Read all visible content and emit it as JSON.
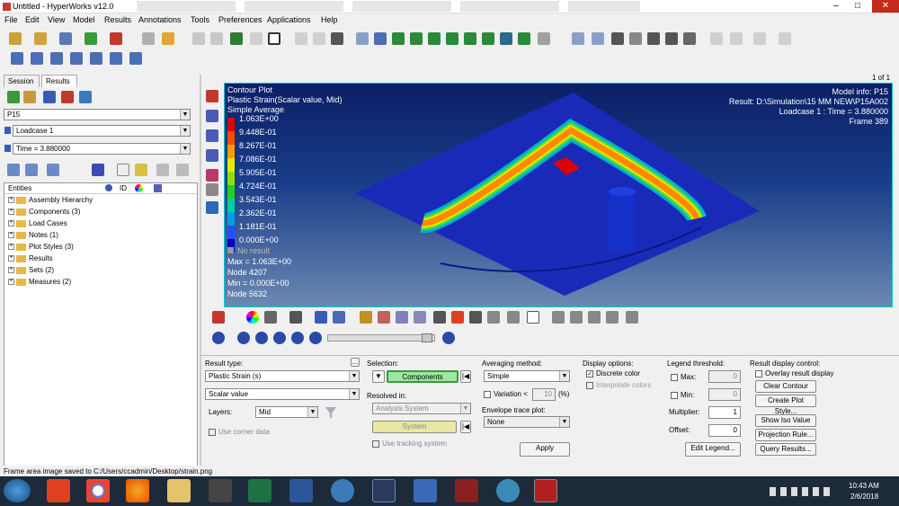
{
  "window": {
    "title": "Untitled - HyperWorks v12.0"
  },
  "menu": [
    "File",
    "Edit",
    "View",
    "Model",
    "Results",
    "Annotations",
    "Tools",
    "Preferences",
    "Applications",
    "Help"
  ],
  "page_counter": "1 of 1",
  "side_tabs": [
    "Session",
    "Results"
  ],
  "model_select": "P15",
  "loadcase_select": "Loadcase 1",
  "time_select": "Time = 3.880000",
  "tree": {
    "col_entities": "Entities",
    "col_id": "ID",
    "items": [
      "Assembly Hierarchy",
      "Components (3)",
      "Load Cases",
      "Notes (1)",
      "Plot Styles (3)",
      "Results",
      "Sets (2)",
      "Measures (2)"
    ]
  },
  "contour": {
    "title": "Contour Plot",
    "subtitle": "Plastic Strain(Scalar value, Mid)",
    "averaging": "Simple Average",
    "levels": [
      "1.063E+00",
      "9.448E-01",
      "8.267E-01",
      "7.086E-01",
      "5.905E-01",
      "4.724E-01",
      "3.543E-01",
      "2.362E-01",
      "1.181E-01",
      "0.000E+00"
    ],
    "level_colors": [
      "#e00000",
      "#ff4a00",
      "#ff9a00",
      "#e8e800",
      "#8fe000",
      "#20d020",
      "#00d0a0",
      "#00a0e0",
      "#2050ff",
      "#0000c0"
    ],
    "no_result": "No result",
    "max": "Max = 1.063E+00",
    "max_node": "Node 4207",
    "min": "Min = 0.000E+00",
    "min_node": "Node 5632"
  },
  "model_info": {
    "line1": "Model info: P15",
    "line2": "Result: D:\\Simulation\\15 MM NEW\\P15A002",
    "line3": "Loadcase 1 : Time = 3.880000",
    "line4": "Frame 389"
  },
  "panel": {
    "result_type_label": "Result type:",
    "result_type": "Plastic Strain (s)",
    "scalar": "Scalar value",
    "layers_label": "Layers:",
    "layers": "Mid",
    "use_corner": "Use corner data",
    "selection_label": "Selection:",
    "components_btn": "Components",
    "resolved_label": "Resolved in:",
    "resolved": "Analysis System",
    "system_btn": "System",
    "use_tracking": "Use tracking system",
    "avg_label": "Averaging method:",
    "avg": "Simple",
    "variation": "Variation <",
    "variation_val": "10",
    "variation_unit": "(%)",
    "envelope_label": "Envelope trace plot:",
    "envelope": "None",
    "apply": "Apply",
    "display_label": "Display options:",
    "discrete": "Discrete color",
    "interpolate": "Interpolate colors",
    "legend_label": "Legend threshold:",
    "max_lbl": "Max:",
    "max_val": "0",
    "min_lbl": "Min:",
    "min_val": "0",
    "multiplier_lbl": "Multiplier:",
    "multiplier_val": "1",
    "offset_lbl": "Offset:",
    "offset_val": "0",
    "edit_legend": "Edit Legend...",
    "result_ctrl_label": "Result display control:",
    "overlay": "Overlay result display",
    "clear_contour": "Clear Contour",
    "create_plot_style": "Create Plot Style...",
    "show_iso": "Show Iso Value",
    "projection": "Projection Rule...",
    "query": "Query Results..."
  },
  "status": "Frame area image saved to C:/Users/ccadmin/Desktop/strain.png",
  "clock": {
    "time": "10:43 AM",
    "date": "2/6/2018"
  }
}
